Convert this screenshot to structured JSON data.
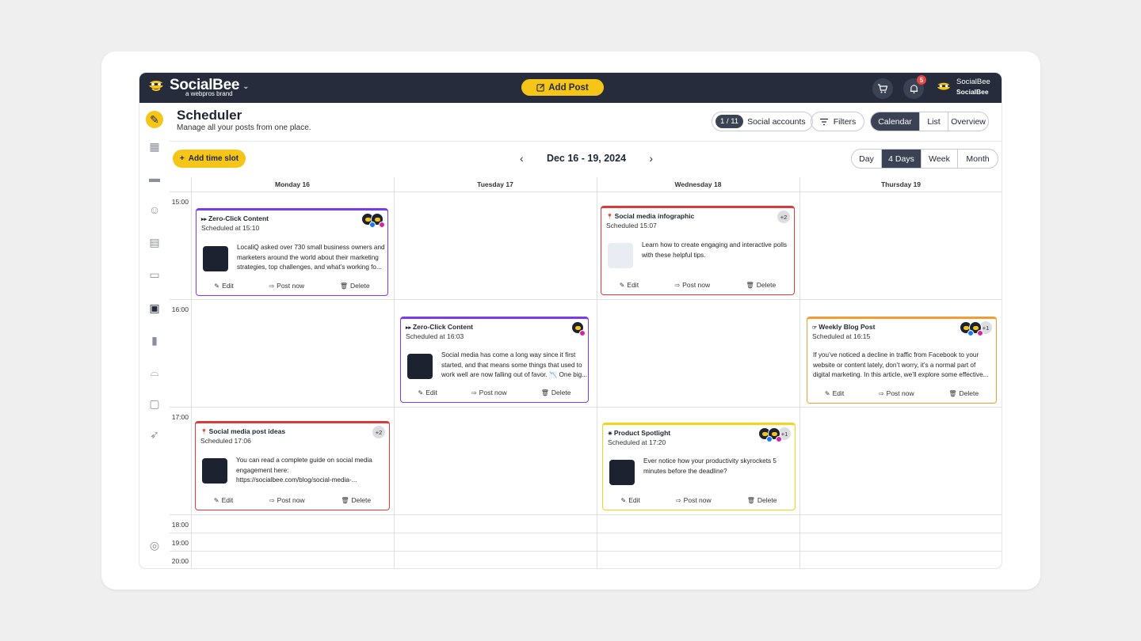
{
  "brand": {
    "name": "SocialBee",
    "sub": "a webpros brand"
  },
  "topbar": {
    "add_post": "Add Post",
    "notif_count": "5",
    "user_name": "SocialBee",
    "user_org": "SocialBee"
  },
  "header": {
    "title": "Scheduler",
    "subtitle": "Manage all your posts from one place."
  },
  "toolbar": {
    "accounts_count": "1 / 11",
    "accounts_label": "Social accounts",
    "filters": "Filters",
    "views": [
      "Calendar",
      "List",
      "Overview"
    ],
    "active_view": "Calendar"
  },
  "calendar": {
    "add_slot": "Add time slot",
    "range": "Dec 16 - 19, 2024",
    "ranges": [
      "Day",
      "4 Days",
      "Week",
      "Month"
    ],
    "active_range": "4 Days",
    "days": [
      "Monday 16",
      "Tuesday 17",
      "Wednesday 18",
      "Thursday 19"
    ],
    "times": [
      "15:00",
      "16:00",
      "17:00",
      "18:00",
      "19:00",
      "20:00"
    ]
  },
  "actions": {
    "edit": "Edit",
    "post_now": "Post now",
    "delete": "Delete"
  },
  "posts": [
    {
      "category": "Zero-Click Content",
      "category_icon": "double-chevron-icon",
      "scheduled": "Scheduled at 15:10",
      "text": "LocaliQ asked over 730 small business owners and marketers around the world about their marketing strategies, top challenges, and what’s working fo...",
      "color": "#7c3aed",
      "extra": ""
    },
    {
      "category": "Social media infographic",
      "category_icon": "pin-icon",
      "scheduled": "Scheduled 15:07",
      "text": "Learn how to create engaging and interactive polls with these helpful tips.",
      "color": "#dc3a3a",
      "extra": "+2"
    },
    {
      "category": "Zero-Click Content",
      "category_icon": "double-chevron-icon",
      "scheduled": "Scheduled at 16:03",
      "text": "Social media has come a long way since it first started, and that means some things that used to work well are now falling out of favor. 📉 One big...",
      "color": "#7c3aed",
      "extra": ""
    },
    {
      "category": "Weekly Blog Post",
      "category_icon": "pointer-icon",
      "scheduled": "Scheduled at 16:15",
      "text": "If you’ve noticed a decline in traffic from Facebook to your website or content lately, don’t worry, it’s a normal part of digital marketing. In this article, we’ll explore some effective...",
      "color": "#f39c34",
      "extra": "+1"
    },
    {
      "category": "Social media post ideas",
      "category_icon": "pin-icon",
      "scheduled": "Scheduled 17:06",
      "text": "You can read a complete guide on social media engagement here: https://socialbee.com/blog/social-media-...",
      "color": "#dc3a3a",
      "extra": "+2"
    },
    {
      "category": "Product Spotlight",
      "category_icon": "star-icon",
      "scheduled": "Scheduled at 17:20",
      "text": "Ever notice how your productivity skyrockets 5 minutes before the deadline?",
      "color": "#f5d31a",
      "extra": "+1"
    }
  ]
}
